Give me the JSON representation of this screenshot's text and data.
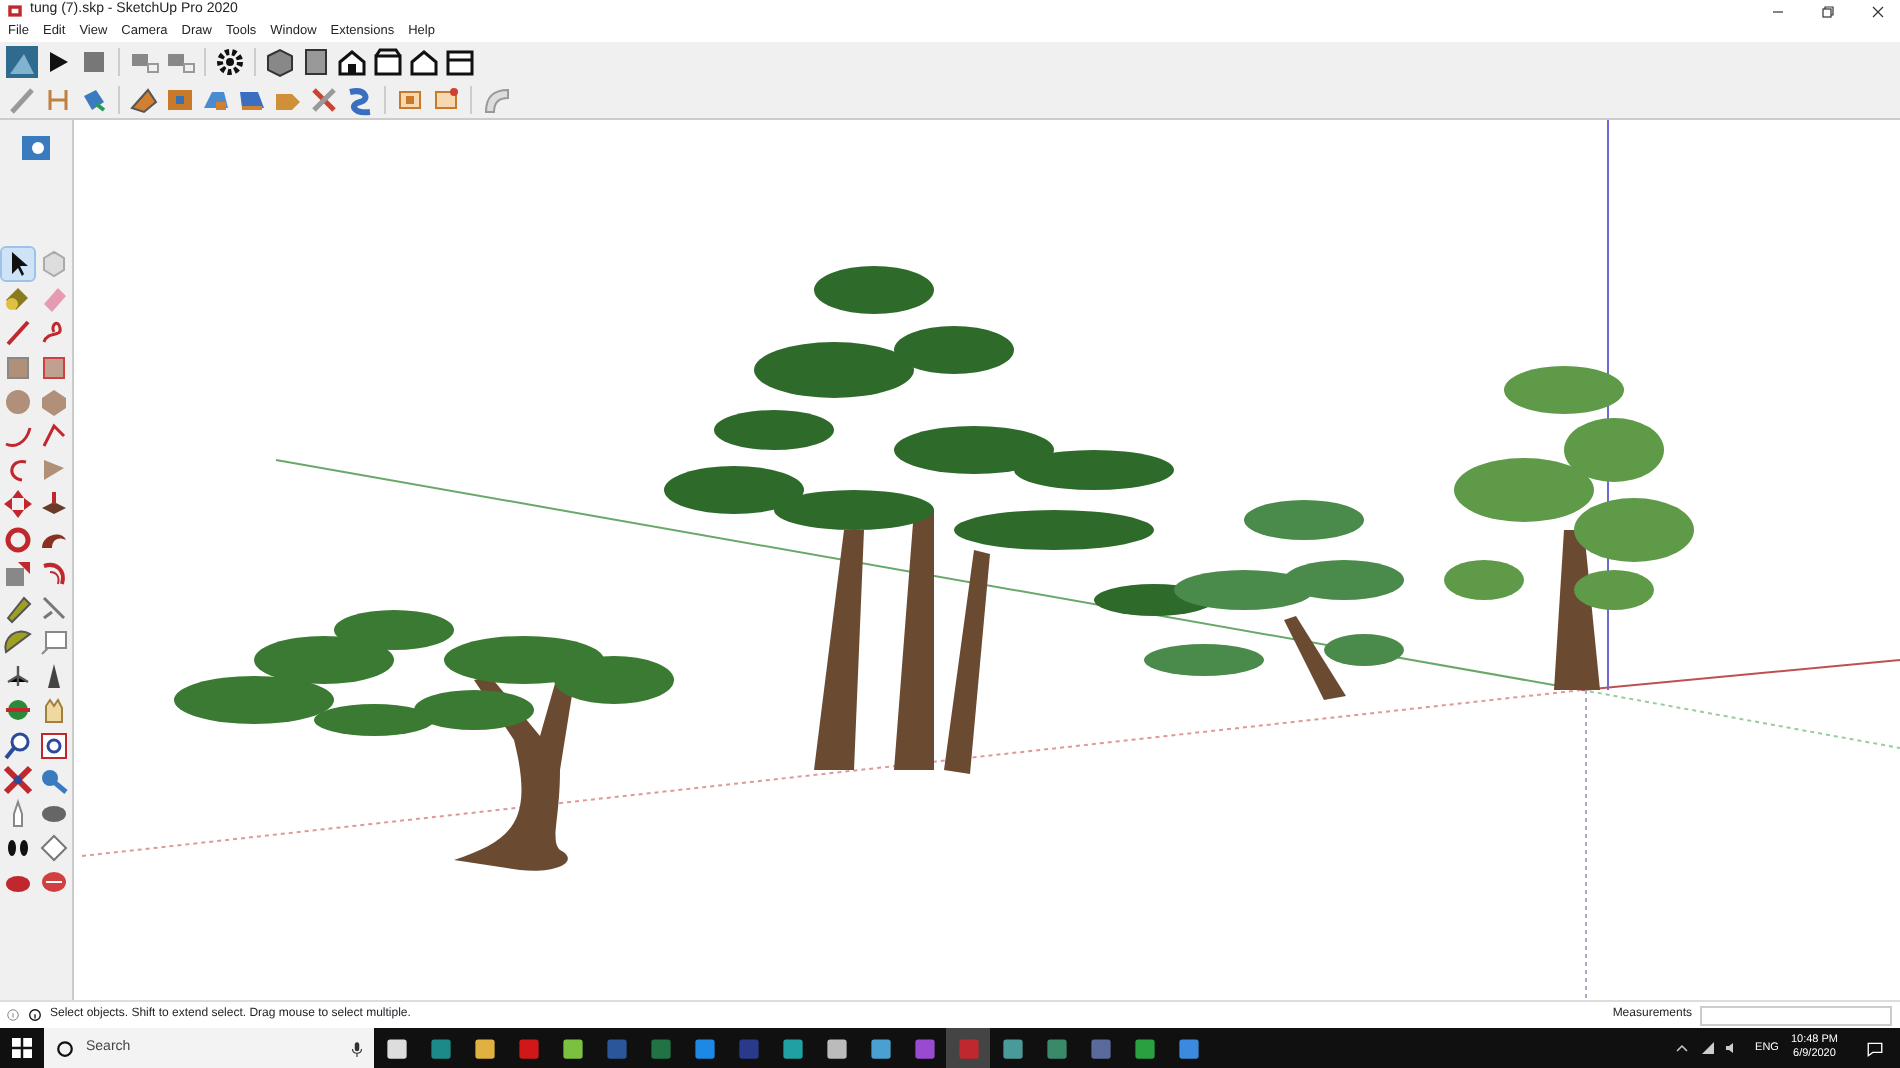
{
  "window": {
    "title": "tung (7).skp - SketchUp Pro 2020"
  },
  "menu": [
    "File",
    "Edit",
    "View",
    "Camera",
    "Draw",
    "Tools",
    "Window",
    "Extensions",
    "Help"
  ],
  "tool_palette": [
    {
      "selected": true
    },
    {
      "selected": false
    },
    {
      "selected": false
    },
    {
      "selected": false
    },
    {
      "selected": false
    },
    {
      "selected": false
    },
    {
      "selected": false
    },
    {
      "selected": false
    },
    {
      "selected": false
    },
    {
      "selected": false
    },
    {
      "selected": false
    },
    {
      "selected": false
    },
    {
      "selected": false
    },
    {
      "selected": false
    },
    {
      "selected": false
    },
    {
      "selected": false
    },
    {
      "selected": false
    },
    {
      "selected": false
    },
    {
      "selected": false
    },
    {
      "selected": false
    },
    {
      "selected": false
    },
    {
      "selected": false
    },
    {
      "selected": false
    },
    {
      "selected": false
    },
    {
      "selected": false
    },
    {
      "selected": false
    },
    {
      "selected": false
    },
    {
      "selected": false
    },
    {
      "selected": false
    },
    {
      "selected": false
    },
    {
      "selected": false
    },
    {
      "selected": false
    },
    {
      "selected": false
    },
    {
      "selected": false
    },
    {
      "selected": false
    },
    {
      "selected": false
    },
    {
      "selected": false
    },
    {
      "selected": false
    }
  ],
  "status_bar": {
    "message": "Select objects. Shift to extend select. Drag mouse to select multiple.",
    "measurements_label": "Measurements"
  },
  "taskbar": {
    "search": {
      "placeholder": "Search"
    },
    "apps": [
      {
        "selected": false
      },
      {
        "selected": false
      },
      {
        "selected": false
      },
      {
        "selected": false
      },
      {
        "selected": false
      },
      {
        "selected": false
      },
      {
        "selected": false
      },
      {
        "selected": false
      },
      {
        "selected": false
      },
      {
        "selected": false
      },
      {
        "selected": false
      },
      {
        "selected": false
      },
      {
        "selected": false
      },
      {
        "selected": true
      },
      {
        "selected": false
      },
      {
        "selected": false
      },
      {
        "selected": false
      },
      {
        "selected": false
      },
      {
        "selected": false
      }
    ],
    "language": "ENG",
    "time": "10:48 PM",
    "date": "6/9/2020"
  }
}
